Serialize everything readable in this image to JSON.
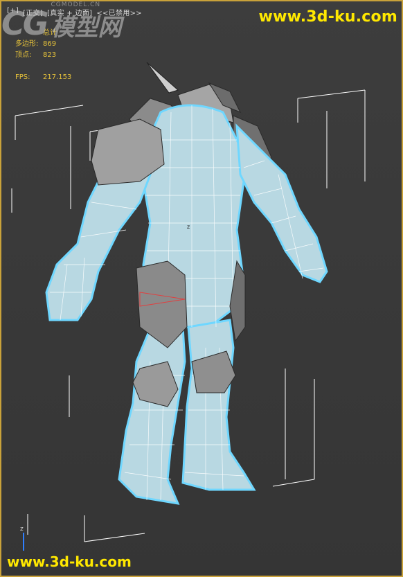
{
  "viewport": {
    "label_plus": "[+]",
    "label_view": "[正交]",
    "label_shading": "[真实 + 边面]",
    "label_disabled": "<<已禁用>>"
  },
  "stats": {
    "header": "总计",
    "polys_label": "多边形:",
    "polys_value": "869",
    "verts_label": "顶点:",
    "verts_value": "823",
    "fps_label": "FPS:",
    "fps_value": "217.153"
  },
  "watermarks": {
    "top": "www.3d-ku.com",
    "bottom": "www.3d-ku.com",
    "cg": "CG",
    "cg_site": "CGMODEL.CN",
    "cg_cn": "模型网"
  },
  "axis": {
    "z": "z"
  },
  "colors": {
    "stats_text": "#e6c23a",
    "watermark": "#ffe800",
    "selection_outline": "#6fd7ff",
    "mesh_fill": "#b8d8e2",
    "armor_fill": "#7e7e7e",
    "bbox": "#ffffff"
  }
}
